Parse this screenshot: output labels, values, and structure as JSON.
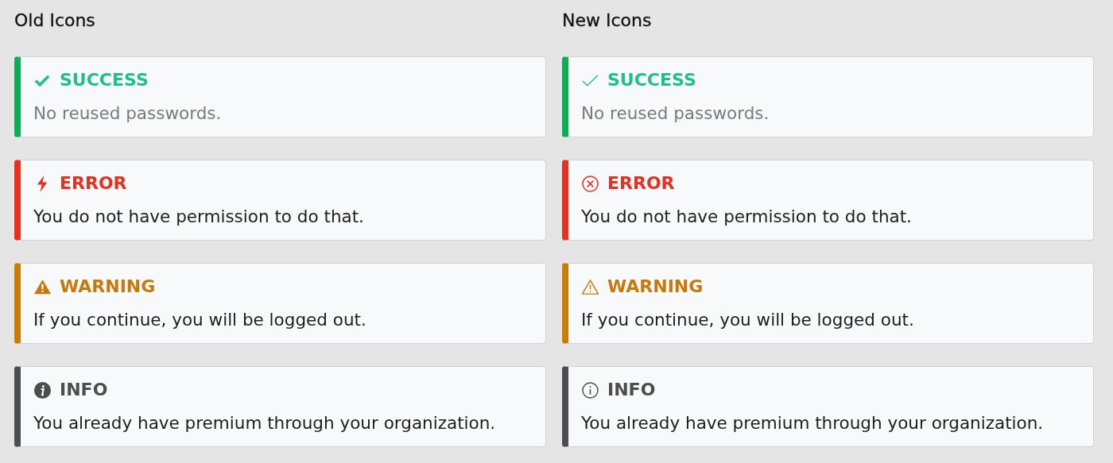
{
  "columns": [
    {
      "heading": "Old Icons",
      "kind": "solid",
      "alerts": [
        {
          "kind": "success",
          "title": "SUCCESS",
          "message": "No reused passwords.",
          "muted": true
        },
        {
          "kind": "error",
          "title": "ERROR",
          "message": "You do not have permission to do that.",
          "muted": false
        },
        {
          "kind": "warning",
          "title": "WARNING",
          "message": "If you continue, you will be logged out.",
          "muted": false
        },
        {
          "kind": "info",
          "title": "INFO",
          "message": "You already have premium through your organization.",
          "muted": false
        }
      ]
    },
    {
      "heading": "New Icons",
      "kind": "outline",
      "alerts": [
        {
          "kind": "success",
          "title": "SUCCESS",
          "message": "No reused passwords.",
          "muted": true
        },
        {
          "kind": "error",
          "title": "ERROR",
          "message": "You do not have permission to do that.",
          "muted": false
        },
        {
          "kind": "warning",
          "title": "WARNING",
          "message": "If you continue, you will be logged out.",
          "muted": false
        },
        {
          "kind": "info",
          "title": "INFO",
          "message": "You already have premium through your organization.",
          "muted": false
        }
      ]
    }
  ]
}
